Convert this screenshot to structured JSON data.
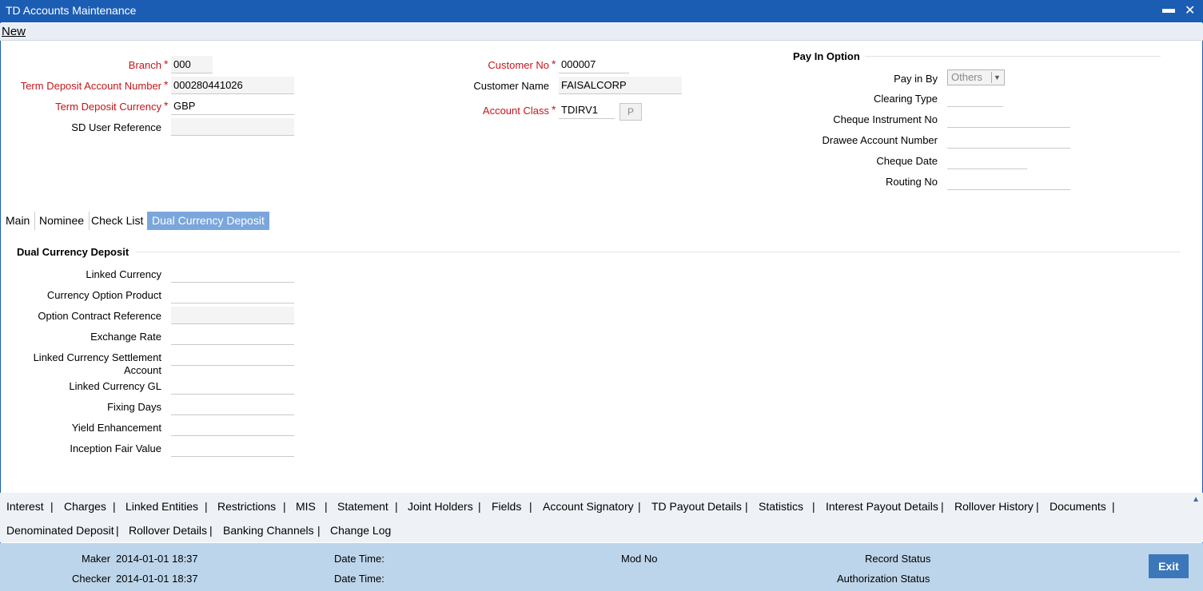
{
  "window": {
    "title": "TD Accounts Maintenance",
    "minimize": "▬",
    "close": "✕"
  },
  "menu": {
    "new": "New"
  },
  "header": {
    "branch": {
      "label": "Branch",
      "value": "000"
    },
    "td_account": {
      "label": "Term Deposit Account Number",
      "value": "000280441026"
    },
    "td_currency": {
      "label": "Term Deposit Currency",
      "value": "GBP"
    },
    "sd_user_ref": {
      "label": "SD User Reference",
      "value": ""
    },
    "customer_no": {
      "label": "Customer No",
      "value": "000007"
    },
    "customer_name": {
      "label": "Customer Name",
      "value": "FAISALCORP"
    },
    "account_class": {
      "label": "Account Class",
      "value": "TDIRV1",
      "button": "P"
    },
    "star": "*"
  },
  "pay_in": {
    "title": "Pay In Option",
    "pay_in_by": {
      "label": "Pay in By",
      "value": "Others"
    },
    "clearing_type": "Clearing Type",
    "cheque_instrument_no": "Cheque Instrument No",
    "drawee_account_number": "Drawee Account Number",
    "cheque_date": "Cheque Date",
    "routing_no": "Routing No"
  },
  "tabs": [
    "Main",
    "Nominee",
    "Check List",
    "Dual Currency Deposit"
  ],
  "dcd": {
    "title": "Dual Currency Deposit",
    "linked_currency": "Linked Currency",
    "currency_option_product": "Currency Option Product",
    "option_contract_reference": "Option Contract Reference",
    "exchange_rate": "Exchange Rate",
    "linked_ccy_settlement_1": "Linked Currency Settlement",
    "linked_ccy_settlement_2": "Account",
    "linked_currency_gl": "Linked Currency GL",
    "fixing_days": "Fixing Days",
    "yield_enhancement": "Yield Enhancement",
    "inception_fair_value": "Inception Fair Value"
  },
  "links": {
    "row1": [
      "Interest",
      "Charges",
      "Linked Entities",
      "Restrictions",
      "MIS",
      "Statement",
      "Joint Holders",
      "Fields",
      "Account Signatory",
      "TD Payout Details",
      "Statistics",
      "Interest Payout Details",
      "Rollover History",
      "Documents"
    ],
    "row2": [
      "Denominated Deposit",
      "Rollover Details",
      "Banking Channels",
      "Change Log"
    ],
    "separator": "|"
  },
  "footer": {
    "maker_label": "Maker",
    "maker_value": "2014-01-01 18:37",
    "checker_label": "Checker",
    "checker_value": "2014-01-01 18:37",
    "date_time_label": "Date Time:",
    "mod_no_label": "Mod No",
    "record_status_label": "Record Status",
    "authorization_status_label": "Authorization Status",
    "exit": "Exit"
  }
}
